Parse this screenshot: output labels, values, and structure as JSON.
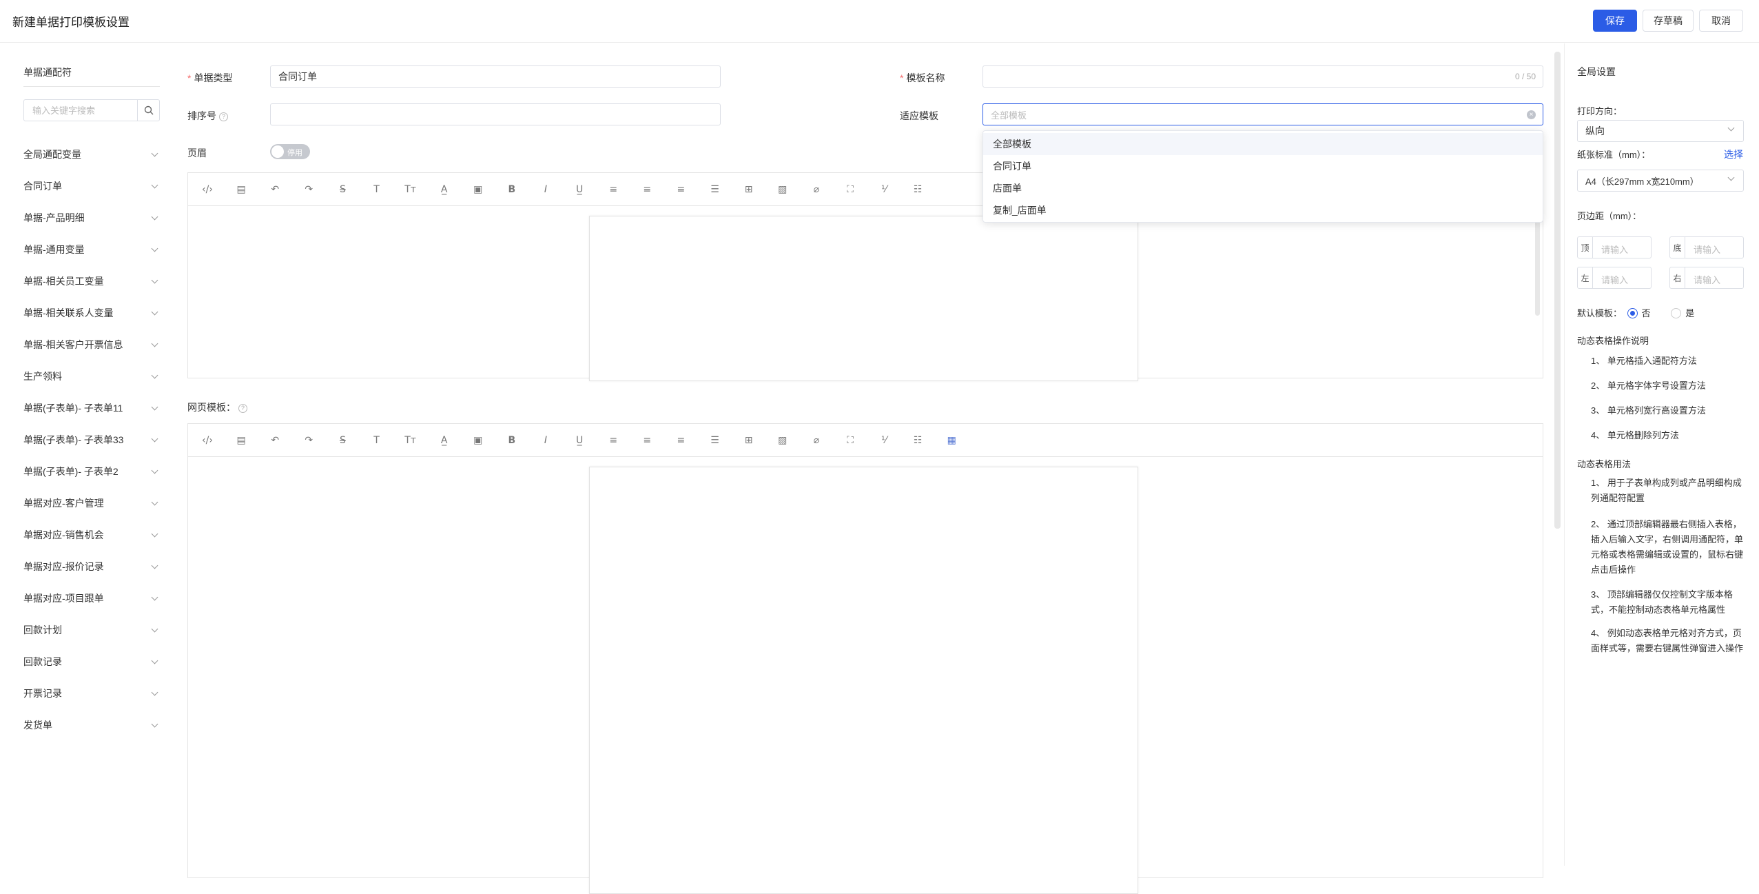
{
  "header": {
    "title": "新建单据打印模板设置",
    "save": "保存",
    "draft": "存草稿",
    "cancel": "取消"
  },
  "left": {
    "title": "单据通配符",
    "search_placeholder": "输入关键字搜索",
    "items": [
      "全局通配变量",
      "合同订单",
      "单据-产品明细",
      "单据-通用变量",
      "单据-相关员工变量",
      "单据-相关联系人变量",
      "单据-相关客户开票信息",
      "生产领料",
      "单据(子表单)- 子表单11",
      "单据(子表单)- 子表单33",
      "单据(子表单)- 子表单2",
      "单据对应-客户管理",
      "单据对应-销售机会",
      "单据对应-报价记录",
      "单据对应-项目跟单",
      "回款计划",
      "回款记录",
      "开票记录",
      "发货单"
    ]
  },
  "form": {
    "doc_type_label": "单据类型",
    "doc_type_value": "合同订单",
    "template_name_label": "模板名称",
    "template_name_count": "0 / 50",
    "sort_label": "排序号",
    "applies_label": "适应模板",
    "applies_placeholder": "全部模板",
    "header_label": "页眉",
    "header_toggle": "停用",
    "web_template_label": "网页模板："
  },
  "dropdown": {
    "options": [
      "全部模板",
      "合同订单",
      "店面单",
      "复制_店面单"
    ],
    "selected": "全部模板"
  },
  "right": {
    "title": "全局设置",
    "orientation_label": "打印方向：",
    "orientation_value": "纵向",
    "paper_label": "纸张标准（mm）：",
    "paper_select": "选择",
    "paper_value": "A4（长297mm x宽210mm）",
    "margin_label": "页边距（mm）：",
    "margin_top": "顶",
    "margin_bottom": "底",
    "margin_left": "左",
    "margin_right": "右",
    "margin_placeholder": "请输入",
    "default_label": "默认模板：",
    "default_no": "否",
    "default_yes": "是",
    "dynamic_ops_title": "动态表格操作说明",
    "dynamic_ops": [
      "1、 单元格插入通配符方法",
      "2、 单元格字体字号设置方法",
      "3、 单元格列宽行高设置方法",
      "4、 单元格删除列方法"
    ],
    "dynamic_usage_title": "动态表格用法",
    "dynamic_usage": [
      "1、 用于子表单构成列或产品明细构成列通配符配置",
      "2、 通过顶部编辑器最右侧插入表格，插入后输入文字，右侧调用通配符，单元格或表格需编辑或设置的，鼠标右键点击后操作",
      "3、 顶部编辑器仅仅控制文字版本格式，不能控制动态表格单元格属性",
      "4、 例如动态表格单元格对齐方式，页面样式等，需要右键属性弹窗进入操作"
    ]
  },
  "toolbar_icons": [
    "source-code-icon",
    "template-icon",
    "undo-icon",
    "redo-icon",
    "strikethrough-icon",
    "font-size-icon",
    "font-family-icon",
    "font-color-icon",
    "background-color-icon",
    "bold-icon",
    "italic-icon",
    "underline-icon",
    "align-left-icon",
    "align-center-icon",
    "align-right-icon",
    "align-justify-icon",
    "table-icon",
    "image-icon",
    "attachment-icon",
    "fullscreen-icon",
    "ordered-list-icon",
    "unordered-list-icon"
  ],
  "colors": {
    "primary": "#2b5ce6",
    "required": "#f56c6c"
  }
}
